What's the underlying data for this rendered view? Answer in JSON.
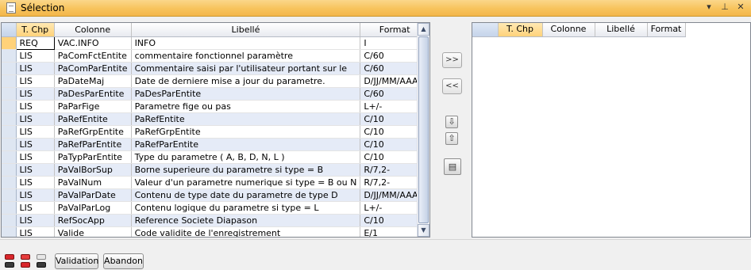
{
  "window": {
    "title": "Sélection"
  },
  "title_controls": [
    "▾",
    "⊥",
    "✕"
  ],
  "left_table": {
    "columns": [
      "T. Chp",
      "Colonne",
      "Libellé",
      "Format"
    ],
    "rows": [
      [
        "REQ",
        "VAC.INFO",
        "INFO",
        "I"
      ],
      [
        "LIS",
        "PaComFctEntite",
        "commentaire fonctionnel paramètre",
        "C/60"
      ],
      [
        "LIS",
        "PaComParEntite",
        "Commentaire saisi par l'utilisateur portant sur le",
        "C/60"
      ],
      [
        "LIS",
        "PaDateMaj",
        "Date de derniere mise a jour du parametre.",
        "D/JJ/MM/AAAA"
      ],
      [
        "LIS",
        "PaDesParEntite",
        "PaDesParEntite",
        "C/60"
      ],
      [
        "LIS",
        "PaParFige",
        "Parametre fige ou pas",
        "L+/-"
      ],
      [
        "LIS",
        "PaRefEntite",
        "PaRefEntite",
        "C/10"
      ],
      [
        "LIS",
        "PaRefGrpEntite",
        "PaRefGrpEntite",
        "C/10"
      ],
      [
        "LIS",
        "PaRefParEntite",
        "PaRefParEntite",
        "C/10"
      ],
      [
        "LIS",
        "PaTypParEntite",
        "Type du parametre ( A, B, D, N, L )",
        "C/10"
      ],
      [
        "LIS",
        "PaValBorSup",
        "Borne superieure du parametre si type = B",
        "R/7,2-"
      ],
      [
        "LIS",
        "PaValNum",
        "Valeur d'un parametre numerique si type = B ou N",
        "R/7,2-"
      ],
      [
        "LIS",
        "PaValParDate",
        "Contenu de type date du parametre de type D",
        "D/JJ/MM/AAAA"
      ],
      [
        "LIS",
        "PaValParLog",
        "Contenu logique du parametre si type = L",
        "L+/-"
      ],
      [
        "LIS",
        "RefSocApp",
        "Reference Societe Diapason",
        "C/10"
      ],
      [
        "LIS",
        "Valide",
        "Code validite de l'enregistrement",
        "E/1"
      ]
    ]
  },
  "middle": {
    "add_label": ">>",
    "remove_label": "<<"
  },
  "right_table": {
    "columns": [
      "T. Chp",
      "Colonne",
      "Libellé",
      "Format"
    ]
  },
  "buttons": {
    "validation": "Validation",
    "abandon": "Abandon"
  },
  "colors": {
    "titlebar": "#f7c35c",
    "selected_header": "#ffd27a",
    "alt_row": "#e5ebf7"
  }
}
